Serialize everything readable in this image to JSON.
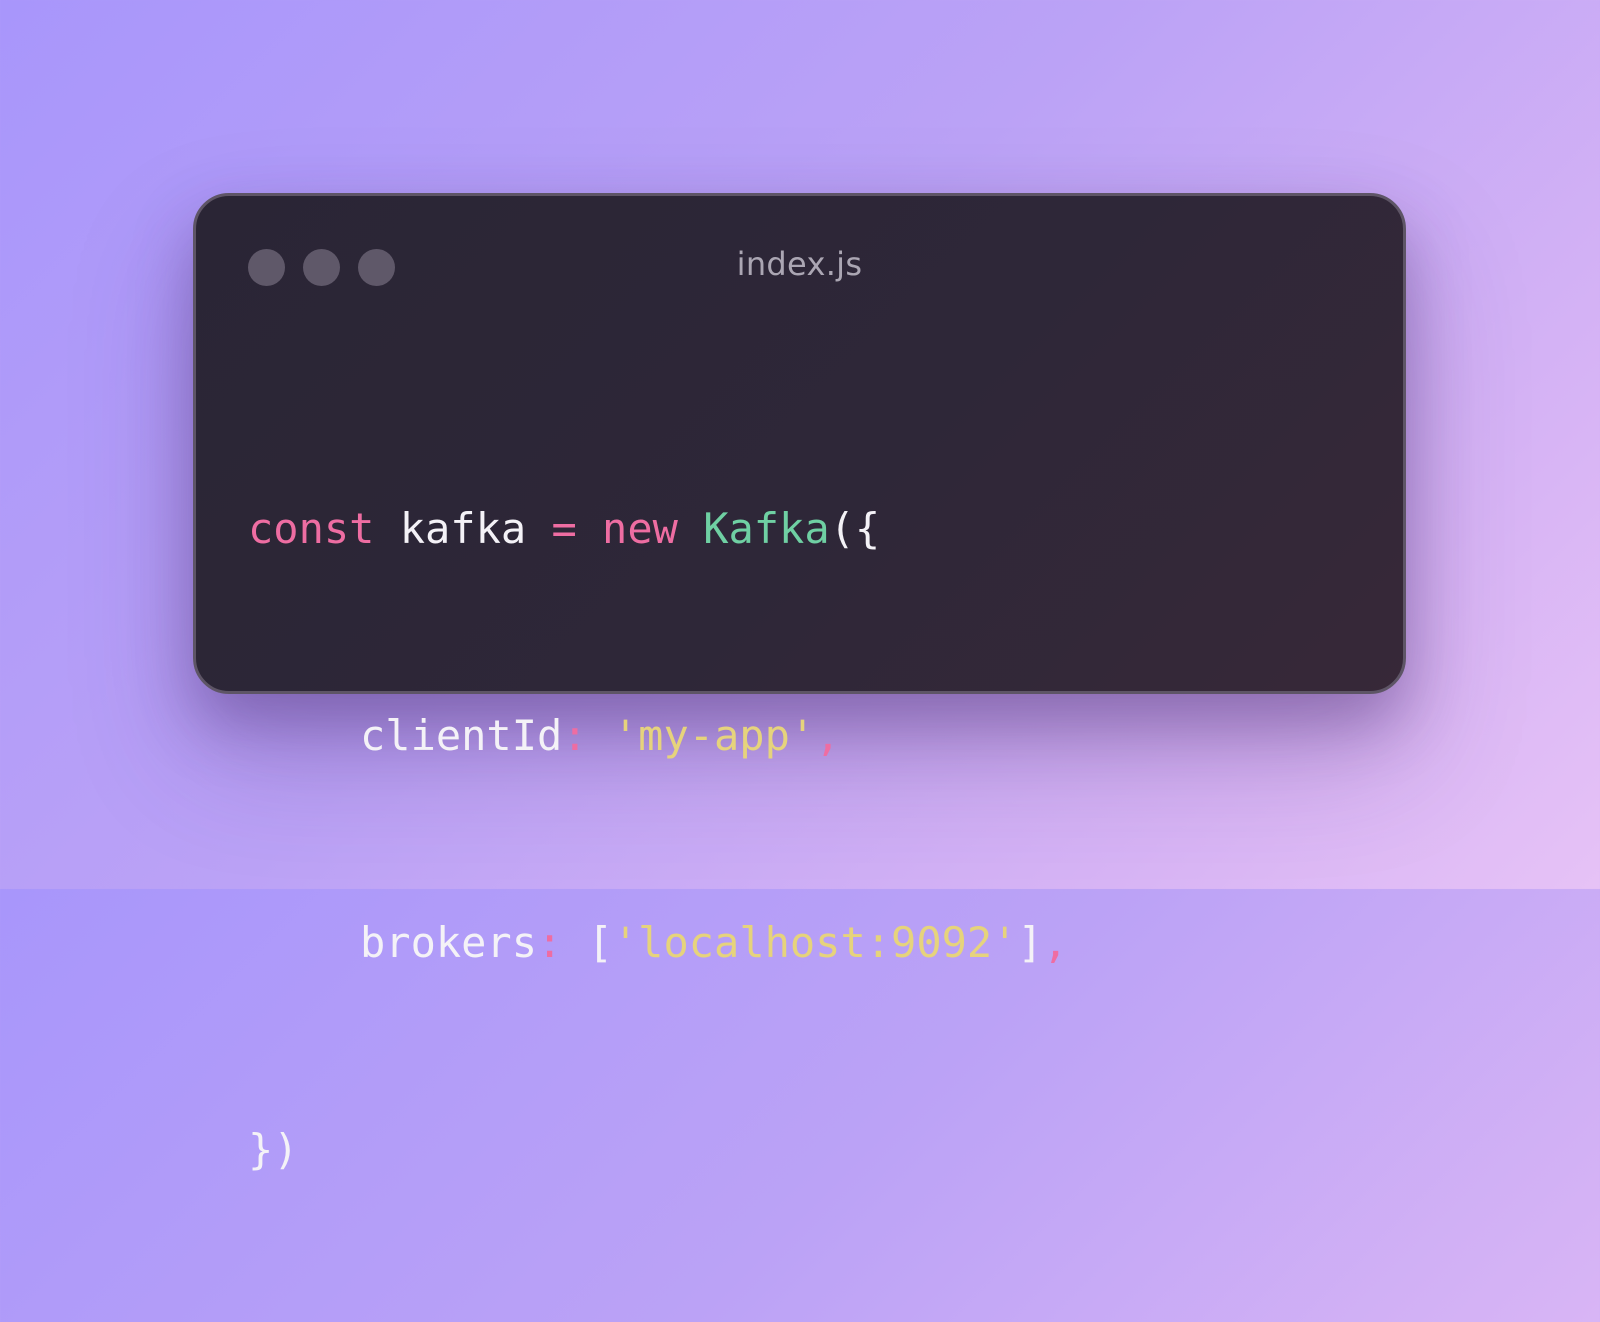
{
  "window": {
    "title": "index.js",
    "controls": [
      "close-dot",
      "minimize-dot",
      "maximize-dot"
    ]
  },
  "code": {
    "line1": {
      "kw_const": "const",
      "var_name": " kafka ",
      "op_equals": "=",
      "kw_new": " new ",
      "class_name": "Kafka",
      "open": "({"
    },
    "line2": {
      "key": "clientId",
      "colon": ":",
      "value": " 'my-app'",
      "comma": ","
    },
    "line3": {
      "key": "brokers",
      "colon": ":",
      "open_bracket": " [",
      "value": "'localhost:9092'",
      "close_bracket": "]",
      "comma": ","
    },
    "line4": {
      "close": "})"
    }
  },
  "colors": {
    "keyword": "#ee6da2",
    "class": "#6fd0a3",
    "string": "#e6d37c",
    "text": "#f4f2f7",
    "title": "#aba6b3",
    "window_bg": "#2e2738"
  }
}
